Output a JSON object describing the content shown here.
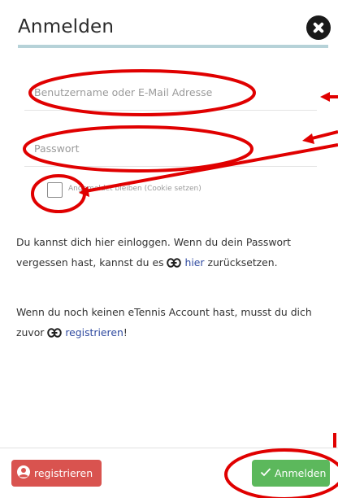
{
  "dialog": {
    "title": "Anmelden"
  },
  "form": {
    "username_placeholder": "Benutzername oder E-Mail Adresse",
    "username_value": "",
    "password_placeholder": "Passwort",
    "password_value": "",
    "remember_label": "Angemeldet bleiben (Cookie setzen)",
    "remember_checked": false
  },
  "info": {
    "p1_text": "Du kannst dich hier einloggen. Wenn du dein Passwort vergessen hast, kannst du es",
    "p1_link": "hier",
    "p1_after": "zurücksetzen.",
    "p2_text": "Wenn du noch keinen eTennis Account hast, musst du dich zuvor",
    "p2_link": "registrieren",
    "p2_after": "!"
  },
  "footer": {
    "register_label": "registrieren",
    "login_label": "Anmelden"
  },
  "colors": {
    "accent_rule": "#b6d2d8",
    "link": "#2f4aa0",
    "register_button": "#d9534f",
    "login_button": "#5cb85c",
    "annotation": "#e00000"
  },
  "icons": {
    "close": "close-circle-icon",
    "link": "link-icon",
    "user": "user-circle-icon",
    "check": "checkmark-icon"
  }
}
